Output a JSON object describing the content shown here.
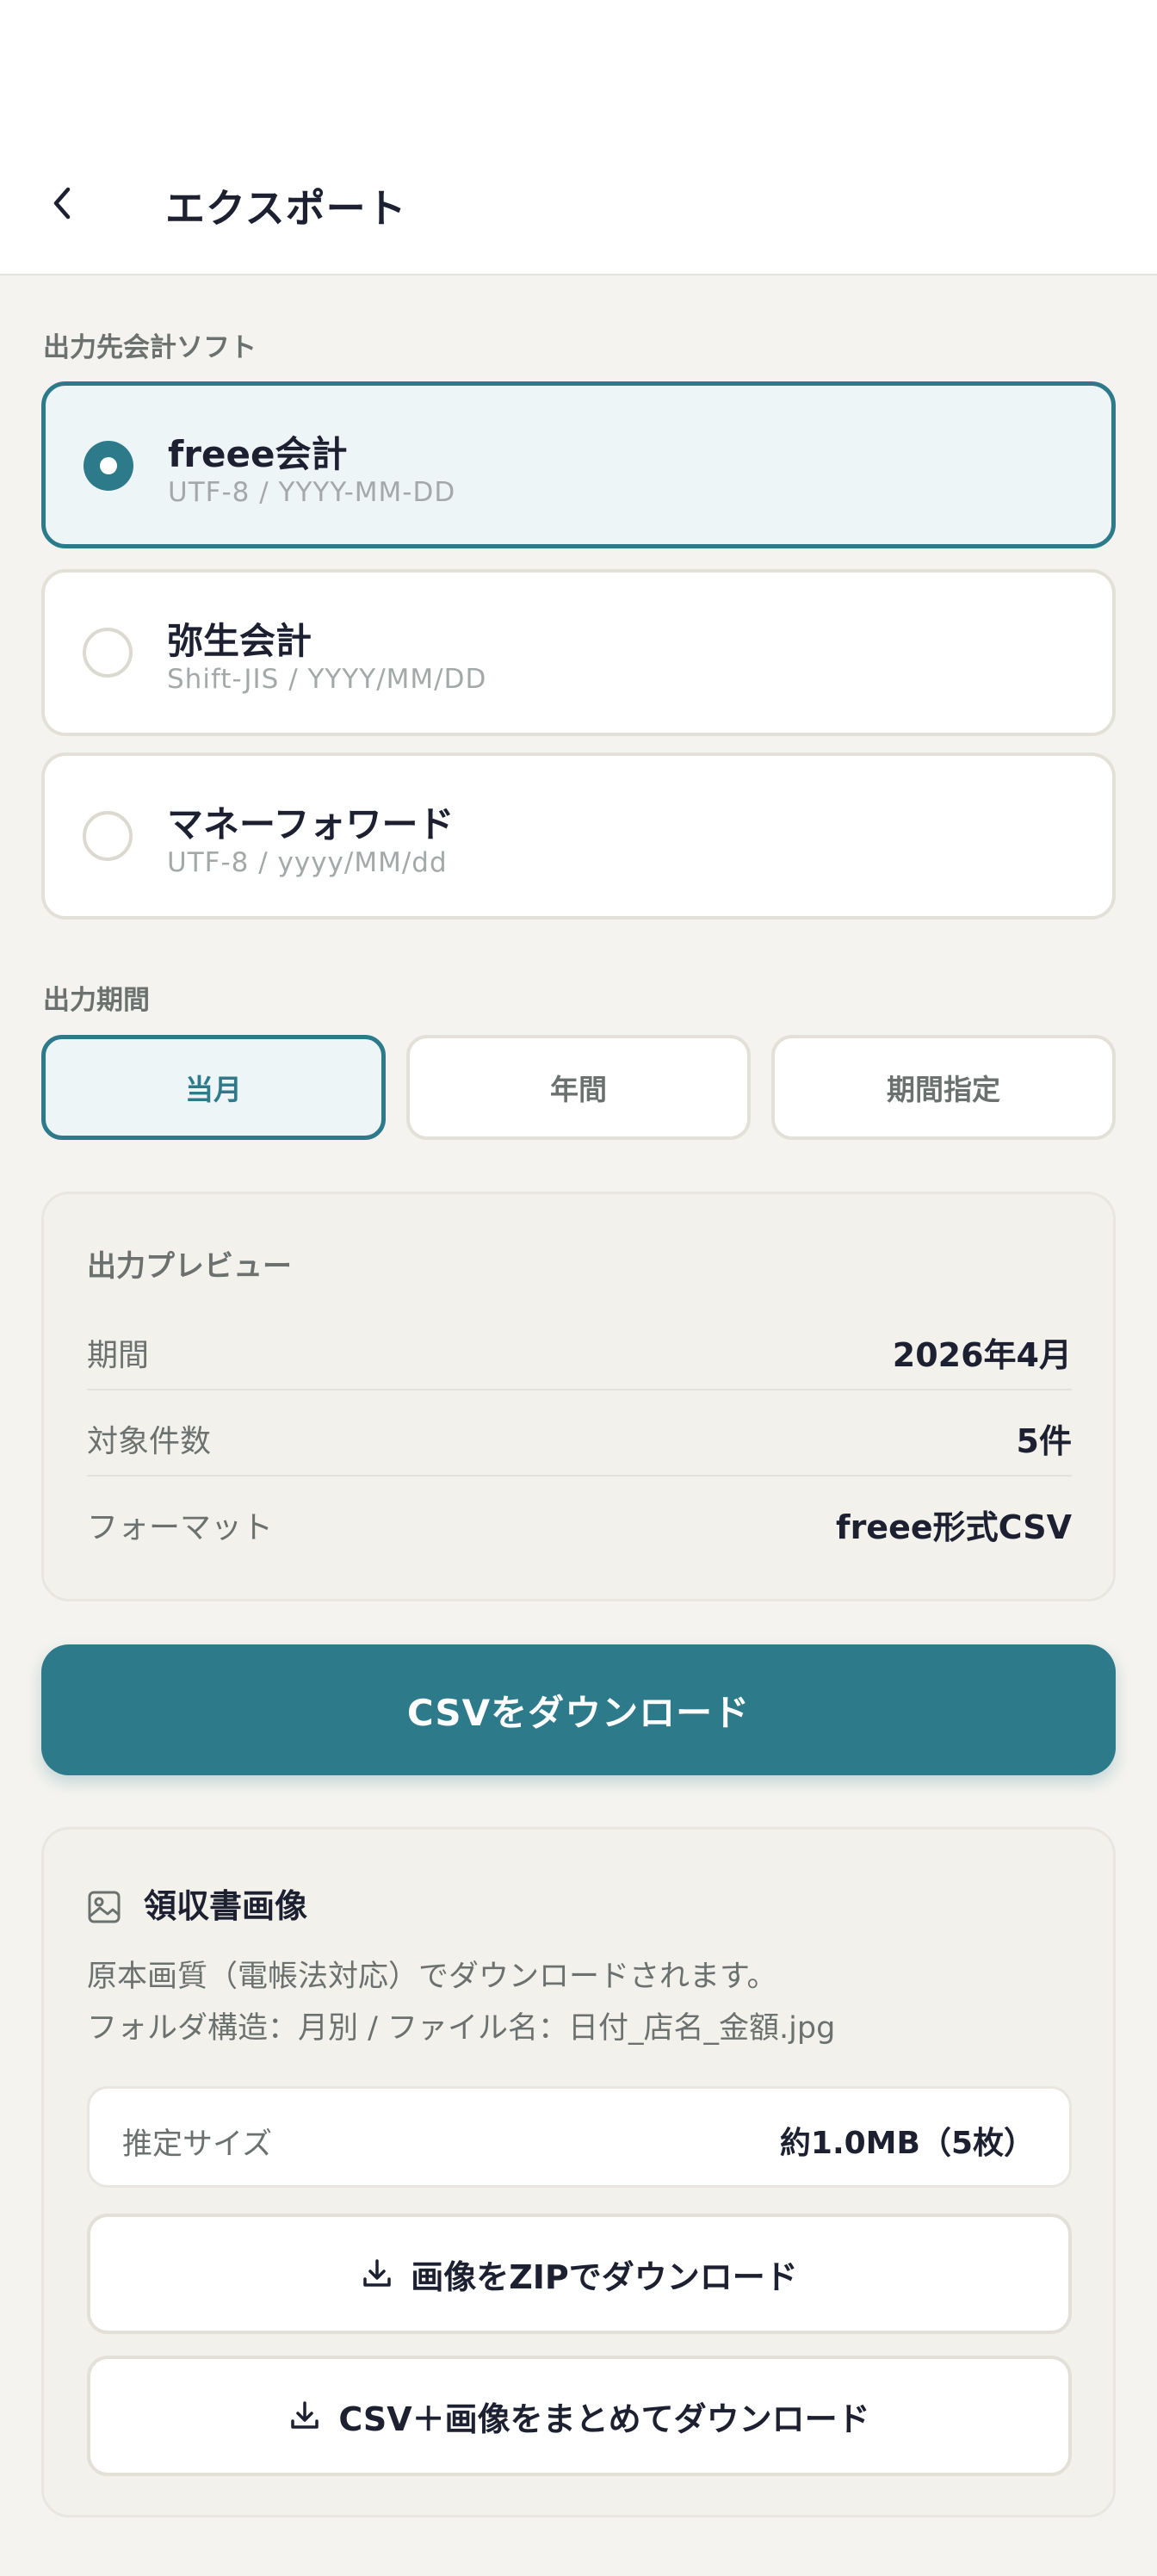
{
  "header": {
    "title": "エクスポート",
    "back_icon": "chevron-left-icon"
  },
  "software": {
    "label": "出力先会計ソフト",
    "options": [
      {
        "name": "freee会計",
        "format": "UTF-8 / YYYY-MM-DD",
        "selected": true
      },
      {
        "name": "弥生会計",
        "format": "Shift-JIS / YYYY/MM/DD",
        "selected": false
      },
      {
        "name": "マネーフォワード",
        "format": "UTF-8 / yyyy/MM/dd",
        "selected": false
      }
    ]
  },
  "period": {
    "label": "出力期間",
    "options": [
      "当月",
      "年間",
      "期間指定"
    ],
    "selected": "当月"
  },
  "preview": {
    "title": "出力プレビュー",
    "rows": [
      {
        "label": "期間",
        "value": "2026年4月"
      },
      {
        "label": "対象件数",
        "value": "5件"
      },
      {
        "label": "フォーマット",
        "value": "freee形式CSV"
      }
    ]
  },
  "csv_button": {
    "label": "CSVをダウンロード"
  },
  "receipt_images": {
    "title": "領収書画像",
    "icon": "image-icon",
    "desc_line1": "原本画質（電帳法対応）でダウンロードされます。",
    "desc_line2": "フォルダ構造：月別 / ファイル名：日付_店名_金額.jpg",
    "size_label": "推定サイズ",
    "size_value": "約1.0MB（5枚）",
    "zip_button": "画像をZIPでダウンロード",
    "bundle_button": "CSV＋画像をまとめてダウンロード",
    "download_icon": "download-icon"
  },
  "colors": {
    "accent": "#2d7a8a",
    "background": "#f4f3ef",
    "selected_bg": "#eef5f7",
    "text_primary": "#1c2030",
    "text_secondary": "#6b716f"
  }
}
